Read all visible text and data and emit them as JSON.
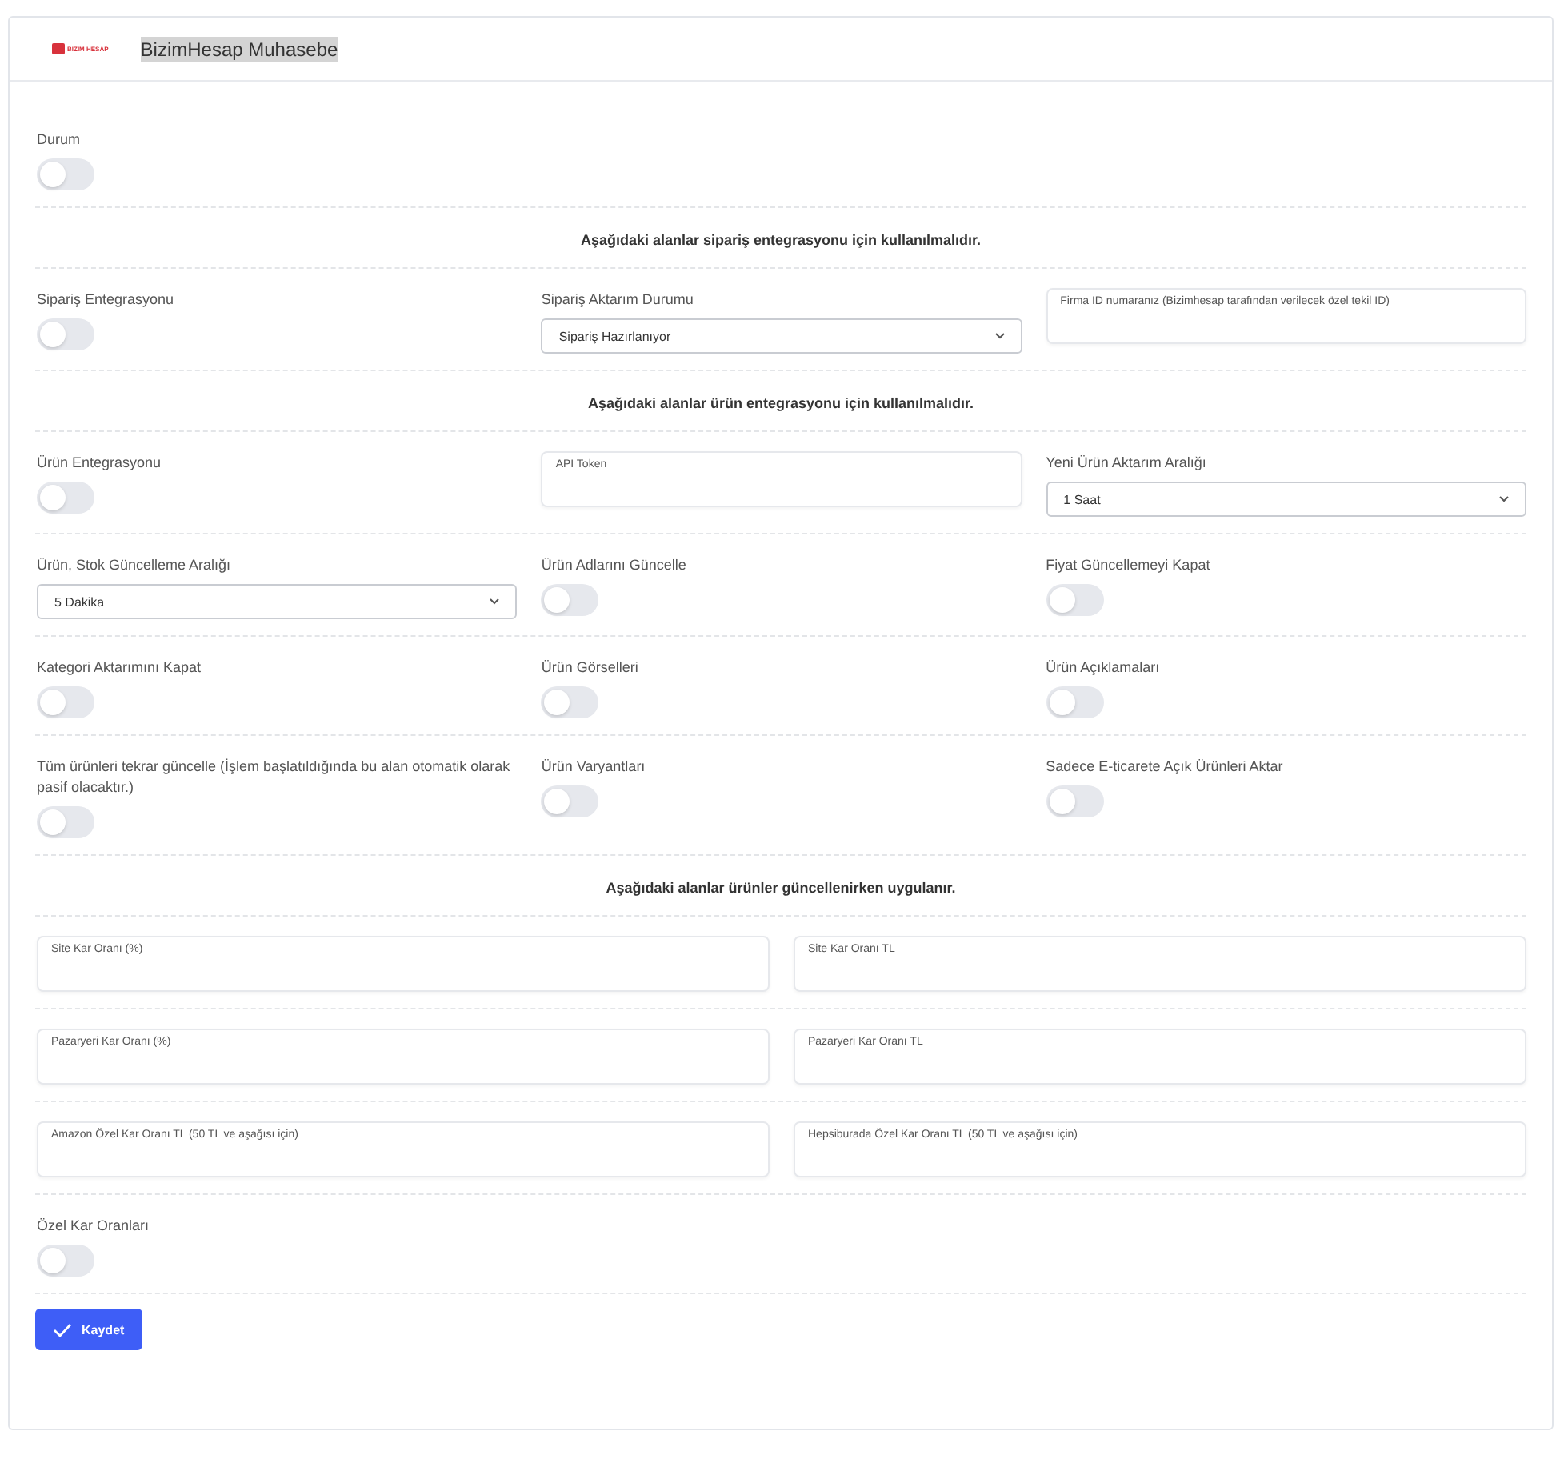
{
  "header": {
    "logo_text": "BIZIM HESAP",
    "title": "BizimHesap Muhasebe"
  },
  "rows": [
    {
      "kind": "three",
      "items": [
        {
          "kind": "toggle",
          "label": "Durum",
          "on": false
        }
      ]
    },
    {
      "kind": "heading",
      "text": "Aşağıdaki alanlar sipariş entegrasyonu için kullanılmalıdır."
    },
    {
      "kind": "three",
      "items": [
        {
          "kind": "toggle",
          "label": "Sipariş Entegrasyonu",
          "on": false
        },
        {
          "kind": "select",
          "label": "Sipariş Aktarım Durumu",
          "value": "Sipariş Hazırlanıyor"
        },
        {
          "kind": "textarea",
          "placeholder": "Firma ID numaranız (Bizimhesap tarafından verilecek özel tekil ID)"
        }
      ]
    },
    {
      "kind": "heading",
      "text": "Aşağıdaki alanlar ürün entegrasyonu için kullanılmalıdır."
    },
    {
      "kind": "three",
      "items": [
        {
          "kind": "toggle",
          "label": "Ürün Entegrasyonu",
          "on": false
        },
        {
          "kind": "textarea",
          "placeholder": "API Token"
        },
        {
          "kind": "select",
          "label": "Yeni Ürün Aktarım Aralığı",
          "value": "1 Saat"
        }
      ]
    },
    {
      "kind": "three",
      "items": [
        {
          "kind": "select",
          "label": "Ürün, Stok Güncelleme Aralığı",
          "value": "5 Dakika"
        },
        {
          "kind": "toggle",
          "label": "Ürün Adlarını Güncelle",
          "on": false
        },
        {
          "kind": "toggle",
          "label": "Fiyat Güncellemeyi Kapat",
          "on": false
        }
      ]
    },
    {
      "kind": "three",
      "items": [
        {
          "kind": "toggle",
          "label": "Kategori Aktarımını Kapat",
          "on": false
        },
        {
          "kind": "toggle",
          "label": "Ürün Görselleri",
          "on": false
        },
        {
          "kind": "toggle",
          "label": "Ürün Açıklamaları",
          "on": false
        }
      ]
    },
    {
      "kind": "three",
      "items": [
        {
          "kind": "toggle",
          "label": "Tüm ürünleri tekrar güncelle (İşlem başlatıldığında bu alan otomatik olarak pasif olacaktır.)",
          "on": false
        },
        {
          "kind": "toggle",
          "label": "Ürün Varyantları",
          "on": false
        },
        {
          "kind": "toggle",
          "label": "Sadece E-ticarete Açık Ürünleri Aktar",
          "on": false
        }
      ]
    },
    {
      "kind": "heading",
      "text": "Aşağıdaki alanlar ürünler güncellenirken uygulanır."
    },
    {
      "kind": "two",
      "items": [
        {
          "kind": "textarea",
          "placeholder": "Site Kar Oranı (%)"
        },
        {
          "kind": "textarea",
          "placeholder": "Site Kar Oranı TL"
        }
      ]
    },
    {
      "kind": "two",
      "items": [
        {
          "kind": "textarea",
          "placeholder": "Pazaryeri Kar Oranı (%)"
        },
        {
          "kind": "textarea",
          "placeholder": "Pazaryeri Kar Oranı TL"
        }
      ]
    },
    {
      "kind": "two",
      "items": [
        {
          "kind": "textarea",
          "placeholder": "Amazon Özel Kar Oranı TL (50 TL ve aşağısı için)"
        },
        {
          "kind": "textarea",
          "placeholder": "Hepsiburada Özel Kar Oranı TL (50 TL ve aşağısı için)"
        }
      ]
    },
    {
      "kind": "three",
      "items": [
        {
          "kind": "toggle",
          "label": "Özel Kar Oranları",
          "on": false
        }
      ]
    }
  ],
  "save_button": "Kaydet"
}
